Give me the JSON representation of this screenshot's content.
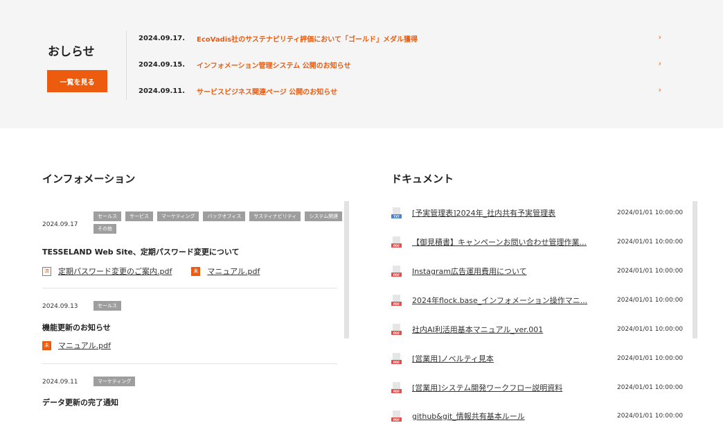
{
  "notice": {
    "title": "おしらせ",
    "view_all_label": "一覧を見る",
    "items": [
      {
        "date": "2024.09.17.",
        "text": "EcoVadis社のサステナビリティ評価において「ゴールド」メダル獲得"
      },
      {
        "date": "2024.09.15.",
        "text": "インフォメーション管理システム 公開のお知らせ"
      },
      {
        "date": "2024.09.11.",
        "text": "サービスビジネス関連ページ 公開のお知らせ"
      }
    ],
    "arrow": "›"
  },
  "information": {
    "title": "インフォメーション",
    "items": [
      {
        "date": "2024.09.17",
        "tags": [
          "セールス",
          "サービス",
          "マーケティング",
          "バックオフィス",
          "サスティナビリティ",
          "システム関連",
          "その他"
        ],
        "heading": "TESSELAND Web Site、定期パスワード変更について",
        "files": [
          {
            "badge": "済",
            "style": "outline",
            "name": "定期パスワード変更のご案内.pdf"
          },
          {
            "badge": "未",
            "style": "solid",
            "name": "マニュアル.pdf"
          }
        ]
      },
      {
        "date": "2024.09.13",
        "tags": [
          "セールス"
        ],
        "heading": "機能更新のお知らせ",
        "files": [
          {
            "badge": "未",
            "style": "solid",
            "name": "マニュアル.pdf"
          }
        ]
      },
      {
        "date": "2024.09.11",
        "tags": [
          "マーケティング"
        ],
        "heading": "データ更新の完了通知",
        "files": []
      }
    ]
  },
  "documents": {
    "title": "ドキュメント",
    "items": [
      {
        "type": "TXT",
        "name": "[予実管理表]2024年_社内共有予実管理表",
        "date": "2024/01/01 10:00:00"
      },
      {
        "type": "PDF",
        "name": "【御見積書】キャンペーンお問い合わせ管理作業...",
        "date": "2024/01/01 10:00:00"
      },
      {
        "type": "PDF",
        "name": "Instagram広告運用費用について",
        "date": "2024/01/01 10:00:00"
      },
      {
        "type": "PDF",
        "name": "2024年flock.base_インフォメーション操作マニ...",
        "date": "2024/01/01 10:00:00"
      },
      {
        "type": "PDF",
        "name": "社内AI利活用基本マニュアル_ver.001",
        "date": "2024/01/01 10:00:00"
      },
      {
        "type": "PDF",
        "name": "[営業用]ノベルティ見本",
        "date": "2024/01/01 10:00:00"
      },
      {
        "type": "PDF",
        "name": "[営業用]システム開発ワークフロー説明資料",
        "date": "2024/01/01 10:00:00"
      },
      {
        "type": "PDF",
        "name": "github&git_情報共有基本ルール",
        "date": "2024/01/01 10:00:00"
      }
    ]
  },
  "colors": {
    "accent": "#ec5b0e",
    "band": "#f5f5f5",
    "tag": "#9e9e9e"
  }
}
